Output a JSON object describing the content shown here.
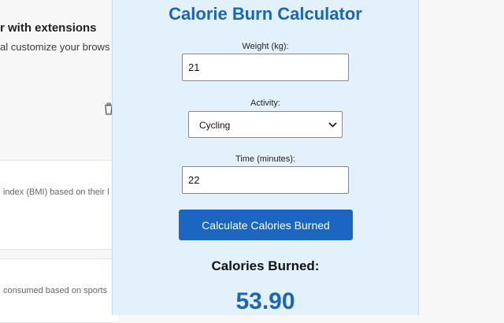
{
  "background": {
    "heading": "r with extensions",
    "subtitle": "al customize your brows",
    "card_1_text": "index (BMI) based on their l",
    "card_2_text": "consumed based on sports"
  },
  "calculator": {
    "title": "Calorie Burn Calculator",
    "weight_label": "Weight (kg):",
    "weight_value": "21",
    "activity_label": "Activity:",
    "activity_selected": "Cycling",
    "time_label": "Time (minutes):",
    "time_value": "22",
    "calculate_label": "Calculate Calories Burned",
    "result_label": "Calories Burned:",
    "result_value": "53.90"
  },
  "colors": {
    "accent": "#1a66b8",
    "button": "#1a66c0",
    "panel_background": "#e3f1fc"
  },
  "icons": {
    "select_arrow": "chevron-down-icon",
    "delete": "trash-icon"
  }
}
